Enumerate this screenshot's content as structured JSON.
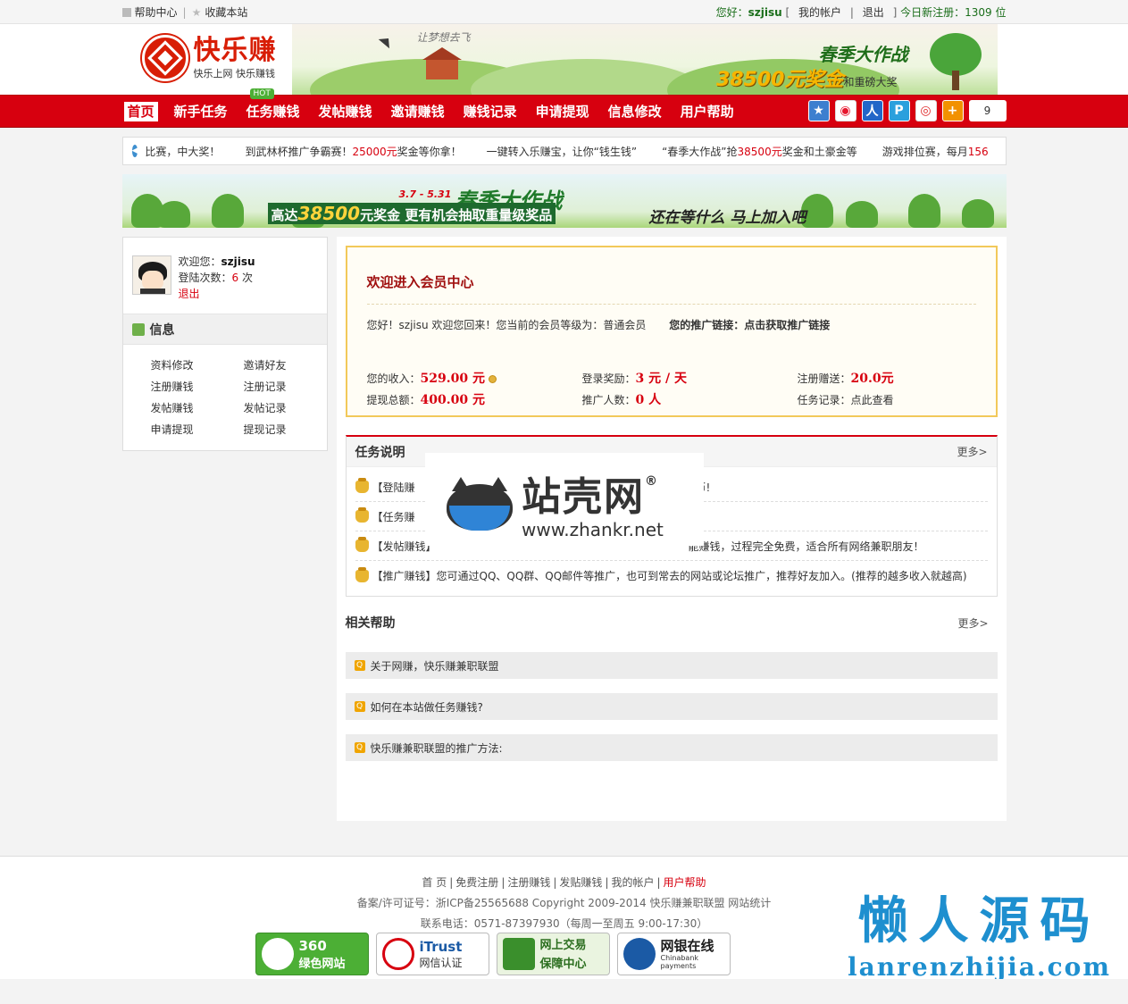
{
  "topbar": {
    "help": "帮助中心",
    "sep": "|",
    "fav": "收藏本站",
    "hello": "您好：",
    "username": "szjisu",
    "bracket_open": "[",
    "my_account": "我的帐户",
    "sep2": "|",
    "logout": "退出",
    "bracket_close": "]",
    "new_reg_label": "今日新注册：",
    "new_reg_count": "1309",
    "new_reg_unit": "位"
  },
  "header": {
    "logo_title": "快乐赚",
    "logo_sub": "快乐上网 快乐赚钱",
    "slogan": "让梦想去飞",
    "promo_title": "春季大作战",
    "promo_amount": "38500元奖金",
    "promo_tail": "和重磅大奖"
  },
  "nav": {
    "items": [
      "首页",
      "新手任务",
      "任务赚钱",
      "发帖赚钱",
      "邀请赚钱",
      "赚钱记录",
      "申请提现",
      "信息修改",
      "用户帮助"
    ],
    "hot_badge": "HOT",
    "share_count": "9",
    "share_icons": [
      "qzone-icon",
      "weibo-icon",
      "renren-icon",
      "pengyou-icon",
      "tencent-weibo-icon",
      "more-share-icon"
    ]
  },
  "notice": {
    "items": [
      {
        "text": "比赛，中大奖！",
        "red": ""
      },
      {
        "pre": "到武林杯推广争霸赛！",
        "red": "25000元",
        "post": "奖金等你拿！"
      },
      {
        "text": "一键转入乐赚宝，让你“钱生钱”"
      },
      {
        "pre": "“春季大作战”抢",
        "red": "38500元",
        "post": "奖金和土豪金等"
      },
      {
        "pre": "游戏排位赛，每月",
        "red": "156"
      }
    ]
  },
  "banner": {
    "dates": "3.7 - 5.31",
    "title": "春季大作战",
    "line_pre": "高达",
    "line_amount": "38500",
    "line_post": "元奖金 更有机会抽取重量级奖品",
    "cta": "还在等什么 马上加入吧"
  },
  "sidebar": {
    "welcome_label": "欢迎您：",
    "username": "szjisu",
    "login_label": "登陆次数：",
    "login_count": "6",
    "login_unit": "次",
    "logout": "退出",
    "section_title": "信息",
    "menu": [
      "资料修改",
      "邀请好友",
      "注册赚钱",
      "注册记录",
      "发帖赚钱",
      "发帖记录",
      "申请提现",
      "提现记录"
    ]
  },
  "welcome": {
    "title": "欢迎进入会员中心",
    "greeting_pre": "您好！",
    "username": "szjisu",
    "greeting_post": "欢迎您回来！您当前的会员等级为：普通会员",
    "promo_link": "您的推广链接：点击获取推广链接",
    "stats": [
      {
        "label": "您的收入：",
        "value": "529.00 元"
      },
      {
        "label": "登录奖励：",
        "value": "3 元 / 天"
      },
      {
        "label": "注册赠送：",
        "value": "20.0元"
      },
      {
        "label": "提现总额：",
        "value": "400.00 元"
      },
      {
        "label": "推广人数：",
        "value": "0 人"
      },
      {
        "label": "任务记录：",
        "value": "点此查看"
      }
    ]
  },
  "tasks": {
    "title": "任务说明",
    "more": "更多>",
    "items": [
      "【登陆赚",
      "【任务赚",
      "【发帖赚钱】",
      "【推广赚钱】您可通过QQ、QQ群、QQ邮件等推广，也可到常去的网站或论坛推广，推荐好友加入。(推荐的越多收入就越高)"
    ],
    "tails": [
      "币!",
      "",
      "能赚钱，过程完全免费，适合所有网络兼职朋友！",
      ""
    ]
  },
  "help": {
    "title": "相关帮助",
    "more": "更多>",
    "items": [
      "关于网赚，快乐赚兼职联盟",
      "如何在本站做任务赚钱?",
      "快乐赚兼职联盟的推广方法:"
    ]
  },
  "watermark": {
    "brand": "站壳网",
    "mark": "®",
    "url": "www.zhankr.net"
  },
  "footer": {
    "links": [
      "首 页",
      "免费注册",
      "注册赚钱",
      "发贴赚钱",
      "我的帐户",
      "用户帮助"
    ],
    "icp": "备案/许可证号：浙ICP备25565688   Copyright 2009-2014 快乐赚兼职联盟  网站统计",
    "phone": "联系电话：0571-87397930（每周一至周五 9:00-17:30）",
    "badges": [
      {
        "title": "360",
        "sub": "绿色网站",
        "color": "#4caf35"
      },
      {
        "title": "iTrust",
        "sub": "网信认证",
        "color": "#d7000f"
      },
      {
        "title": "网上交易",
        "sub": "保障中心",
        "color": "#3a8f2c"
      },
      {
        "title": "网银在线",
        "sub": "Chinabank payments",
        "color": "#1b5aa5"
      }
    ]
  },
  "lanren": {
    "cn": "懒人源码",
    "url": "lanrenzhijia.com"
  }
}
